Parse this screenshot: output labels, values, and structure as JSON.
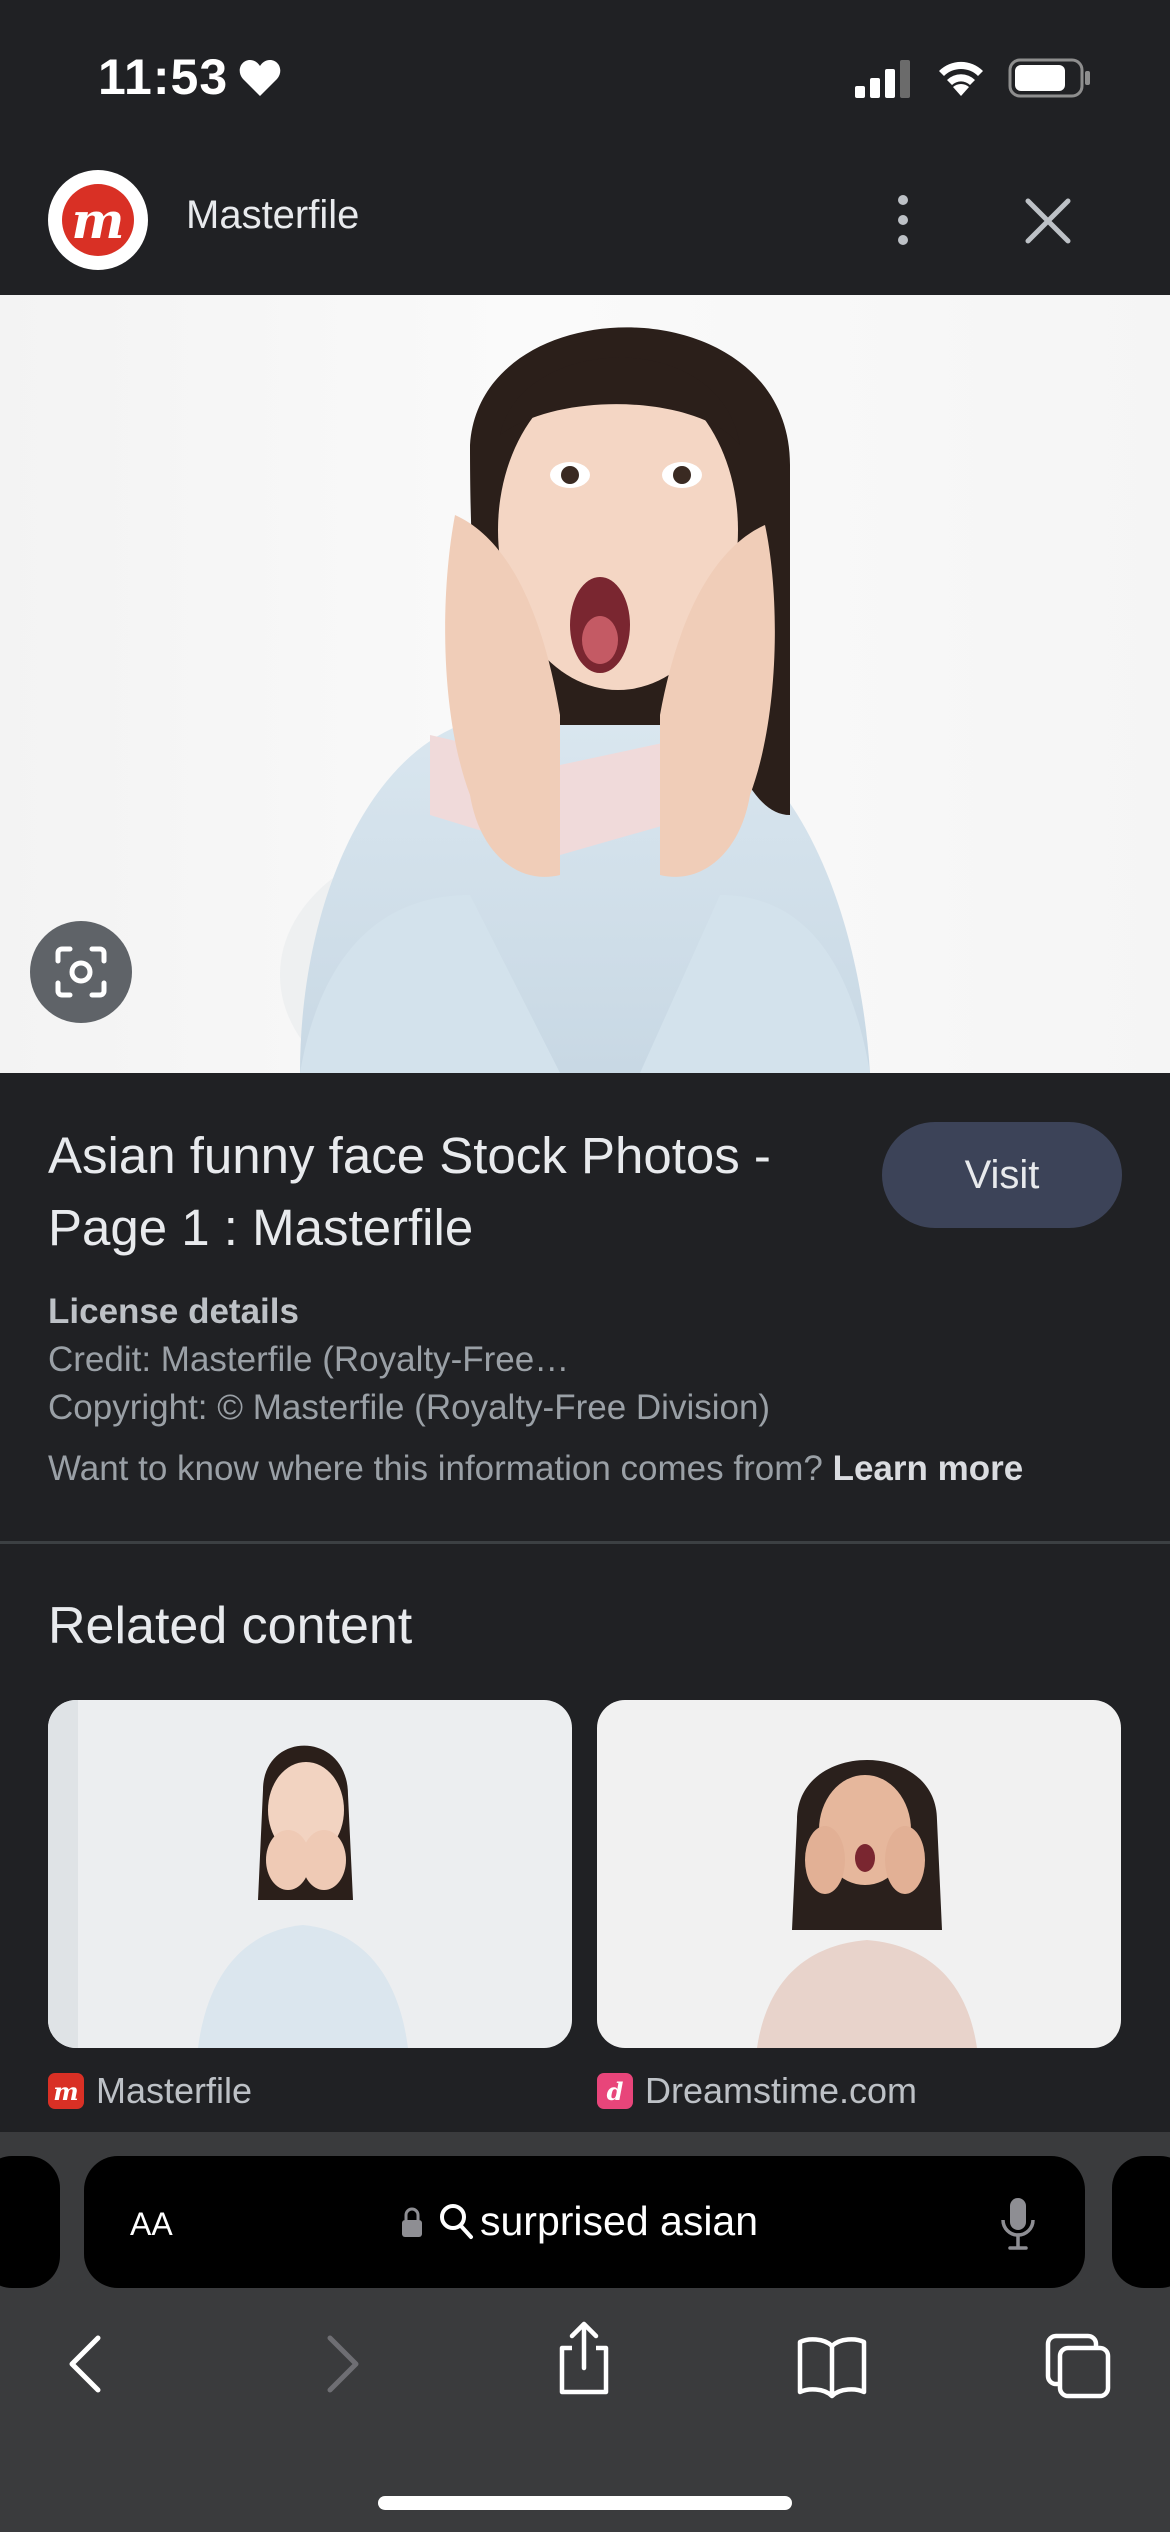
{
  "status_bar": {
    "time": "11:53",
    "icons": [
      "heart-icon",
      "signal-icon",
      "wifi-icon",
      "battery-icon"
    ]
  },
  "header": {
    "site_name": "Masterfile",
    "logo_letter": "m",
    "icons": [
      "more-vertical-icon",
      "close-icon"
    ]
  },
  "result": {
    "title": "Asian funny face Stock Photos - Page 1 : Masterfile",
    "visit_label": "Visit",
    "license_heading": "License details",
    "credit": "Credit: Masterfile (Royalty-Free…",
    "copyright": "Copyright: © Masterfile (Royalty-Free Division)",
    "info_prefix": "Want to know where this information comes from?",
    "learn_more": "Learn more"
  },
  "related": {
    "heading": "Related content",
    "items": [
      {
        "source": "Masterfile",
        "favicon_letter": "m"
      },
      {
        "source": "Dreamstime.com",
        "favicon_letter": "d"
      }
    ]
  },
  "safari": {
    "text_size_label": "AA",
    "address": "surprised asian",
    "icons": [
      "lock-icon",
      "search-icon",
      "mic-icon",
      "back-icon",
      "forward-icon",
      "share-icon",
      "bookmarks-icon",
      "tabs-icon"
    ]
  },
  "colors": {
    "background": "#202124",
    "visit_button": "#3c4358",
    "brand_red": "#d93025",
    "safari_bar": "#3a3b3d"
  }
}
